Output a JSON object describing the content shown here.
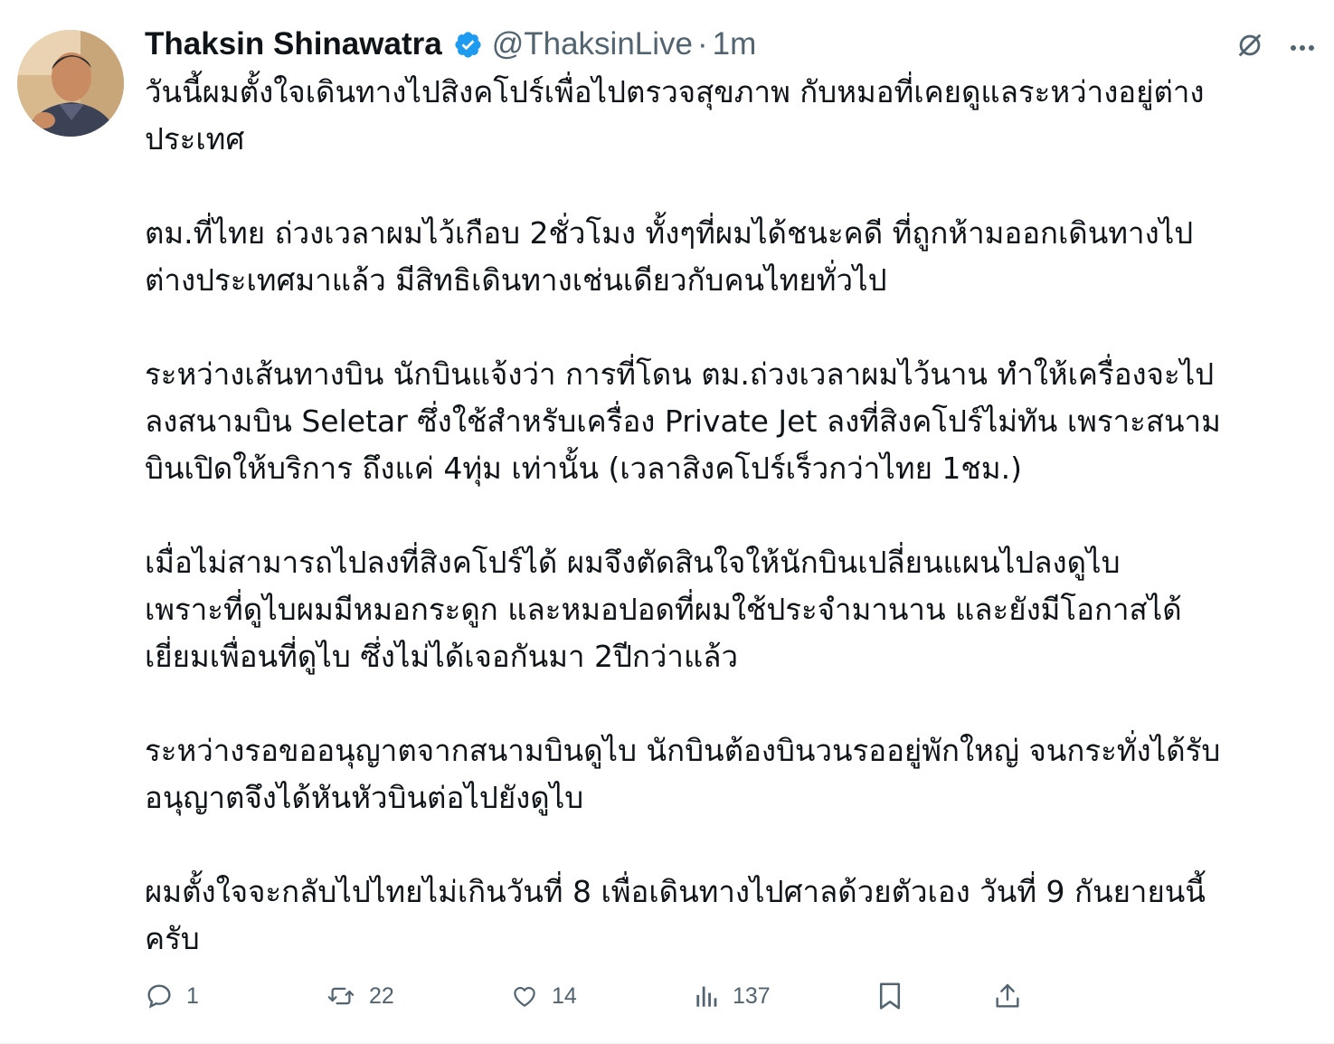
{
  "tweet": {
    "author_name": "Thaksin Shinawatra",
    "handle": "@ThaksinLive",
    "separator": "·",
    "time": "1m",
    "paragraphs": [
      "วันนี้ผมตั้งใจเดินทางไปสิงคโปร์เพื่อไปตรวจสุขภาพ กับหมอที่เคยดูแลระหว่างอยู่ต่าง\nประเทศ",
      "ตม.ที่ไทย ถ่วงเวลาผมไว้เกือบ 2ชั่วโมง ทั้งๆที่ผมได้ชนะคดี ที่ถูกห้ามออกเดินทางไป\nต่างประเทศมาแล้ว มีสิทธิเดินทางเช่นเดียวกับคนไทยทั่วไป",
      "ระหว่างเส้นทางบิน นักบินแจ้งว่า การที่โดน ตม.ถ่วงเวลาผมไว้นาน ทำให้เครื่องจะไป\nลงสนามบิน Seletar ซึ่งใช้สำหรับเครื่อง Private Jet ลงที่สิงคโปร์ไม่ทัน เพราะสนาม\nบินเปิดให้บริการ ถึงแค่ 4ทุ่ม เท่านั้น (เวลาสิงคโปร์เร็วกว่าไทย 1ชม.)",
      "เมื่อไม่สามารถไปลงที่สิงคโปร์ได้  ผมจึงตัดสินใจให้นักบินเปลี่ยนแผนไปลงดูไบ\nเพราะที่ดูไบผมมีหมอกระดูก และหมอปอดที่ผมใช้ประจำมานาน และยังมีโอกาสได้\nเยี่ยมเพื่อนที่ดูไบ ซึ่งไม่ได้เจอกันมา 2ปีกว่าแล้ว",
      "ระหว่างรอขออนุญาตจากสนามบินดูไบ นักบินต้องบินวนรออยู่พักใหญ่ จนกระทั่งได้รับ\nอนุญาตจึงได้หันหัวบินต่อไปยังดูไบ",
      "ผมตั้งใจจะกลับไปไทยไม่เกินวันที่ 8 เพื่อเดินทางไปศาลด้วยตัวเอง วันที่ 9 กันยายนนี้\nครับ"
    ]
  },
  "actions": {
    "reply_count": "1",
    "retweet_count": "22",
    "like_count": "14",
    "views_count": "137"
  },
  "icons": {
    "verified": "verified-badge-icon",
    "grok": "slash-circle-icon",
    "more": "more-dots-icon",
    "reply": "reply-icon",
    "retweet": "retweet-icon",
    "like": "heart-icon",
    "views": "views-icon",
    "bookmark": "bookmark-icon",
    "share": "share-icon"
  },
  "colors": {
    "text": "#0f1419",
    "secondary": "#536471",
    "verified": "#1d9bf0"
  }
}
